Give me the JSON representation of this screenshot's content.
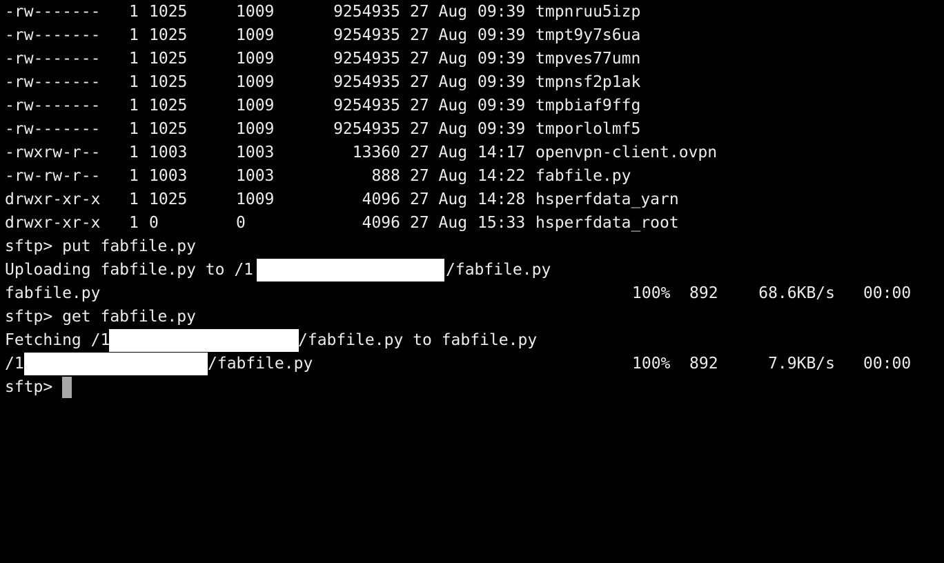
{
  "listing": [
    {
      "perm": "-rw-------",
      "links": "1",
      "uid": "1025",
      "gid": "1009",
      "size": "9254935",
      "date": "27 Aug",
      "time": "09:39",
      "name": "tmpnruu5izp"
    },
    {
      "perm": "-rw-------",
      "links": "1",
      "uid": "1025",
      "gid": "1009",
      "size": "9254935",
      "date": "27 Aug",
      "time": "09:39",
      "name": "tmpt9y7s6ua"
    },
    {
      "perm": "-rw-------",
      "links": "1",
      "uid": "1025",
      "gid": "1009",
      "size": "9254935",
      "date": "27 Aug",
      "time": "09:39",
      "name": "tmpves77umn"
    },
    {
      "perm": "-rw-------",
      "links": "1",
      "uid": "1025",
      "gid": "1009",
      "size": "9254935",
      "date": "27 Aug",
      "time": "09:39",
      "name": "tmpnsf2p1ak"
    },
    {
      "perm": "-rw-------",
      "links": "1",
      "uid": "1025",
      "gid": "1009",
      "size": "9254935",
      "date": "27 Aug",
      "time": "09:39",
      "name": "tmpbiaf9ffg"
    },
    {
      "perm": "-rw-------",
      "links": "1",
      "uid": "1025",
      "gid": "1009",
      "size": "9254935",
      "date": "27 Aug",
      "time": "09:39",
      "name": "tmporlolmf5"
    },
    {
      "perm": "-rwxrw-r--",
      "links": "1",
      "uid": "1003",
      "gid": "1003",
      "size": "13360",
      "date": "27 Aug",
      "time": "14:17",
      "name": "openvpn-client.ovpn"
    },
    {
      "perm": "-rw-rw-r--",
      "links": "1",
      "uid": "1003",
      "gid": "1003",
      "size": "888",
      "date": "27 Aug",
      "time": "14:22",
      "name": "fabfile.py"
    },
    {
      "perm": "drwxr-xr-x",
      "links": "1",
      "uid": "1025",
      "gid": "1009",
      "size": "4096",
      "date": "27 Aug",
      "time": "14:28",
      "name": "hsperfdata_yarn"
    },
    {
      "perm": "drwxr-xr-x",
      "links": "1",
      "uid": "0",
      "gid": "0",
      "size": "4096",
      "date": "27 Aug",
      "time": "15:33",
      "name": "hsperfdata_root"
    }
  ],
  "session": {
    "put_cmd": "sftp> put fabfile.py",
    "upload_prefix": "Uploading fabfile.py to /1",
    "upload_suffix": "/fabfile.py",
    "upload_progress": {
      "file": "fabfile.py",
      "percent": "100%",
      "bytes": "892",
      "rate": "68.6KB/s",
      "eta": "00:00"
    },
    "get_cmd": "sftp> get fabfile.py",
    "fetch_prefix": "Fetching /1",
    "fetch_suffix": "/fabfile.py to fabfile.py",
    "download_progress": {
      "file_prefix": "/1",
      "file_suffix": "/fabfile.py",
      "percent": "100%",
      "bytes": "892",
      "rate": "7.9KB/s",
      "eta": "00:00"
    },
    "prompt": "sftp> "
  },
  "colors": {
    "background": "#000000",
    "foreground": "#ececec",
    "cursor": "#a7a7a7",
    "redaction": "#ffffff"
  }
}
